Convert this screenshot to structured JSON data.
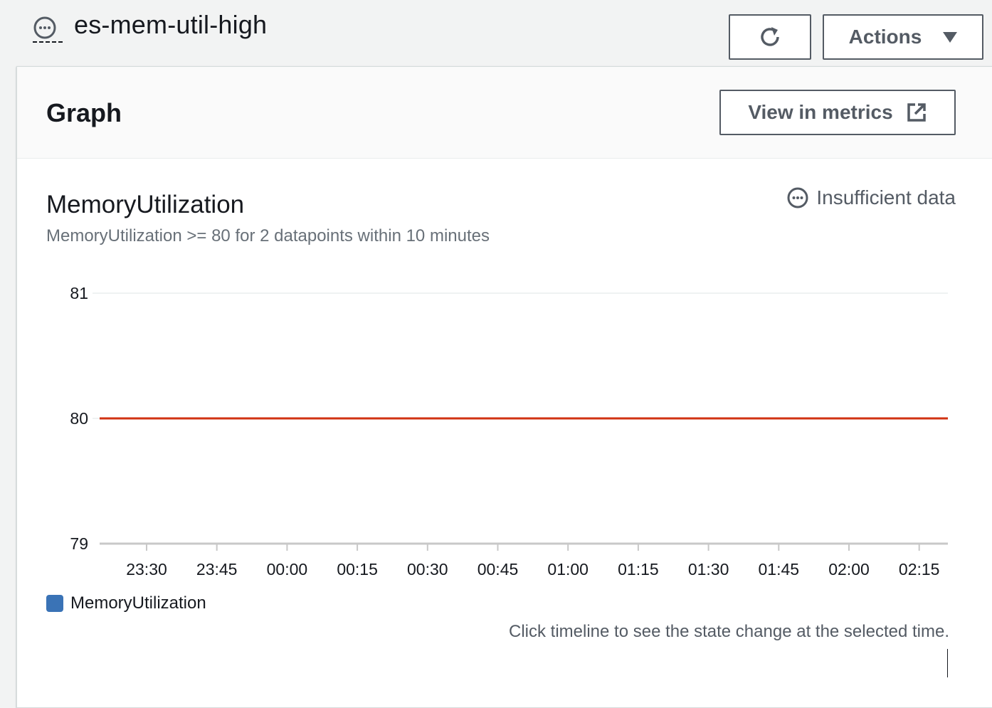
{
  "header": {
    "title": "es-mem-util-high",
    "status_icon": "insufficient-data-icon",
    "refresh_icon": "refresh-icon",
    "actions_label": "Actions"
  },
  "panel": {
    "title": "Graph",
    "view_metrics_label": "View in metrics",
    "external_icon": "external-link-icon"
  },
  "metric": {
    "name": "MemoryUtilization",
    "condition": "MemoryUtilization >= 80 for 2 datapoints within 10 minutes",
    "state_label": "Insufficient data",
    "hint": "Click timeline to see the state change at the selected time."
  },
  "chart_data": {
    "type": "line",
    "xlabel": "",
    "ylabel": "",
    "x_ticks": [
      "23:30",
      "23:45",
      "00:00",
      "00:15",
      "00:30",
      "00:45",
      "01:00",
      "01:15",
      "01:30",
      "01:45",
      "02:00",
      "02:15"
    ],
    "y_ticks": [
      81,
      80,
      79
    ],
    "ylim": [
      79,
      81
    ],
    "series": [
      {
        "name": "MemoryUtilization",
        "color": "#3a73b6",
        "values": []
      }
    ],
    "threshold": {
      "value": 80,
      "color": "#d13212"
    },
    "legend_position": "bottom-left",
    "grid": true
  }
}
